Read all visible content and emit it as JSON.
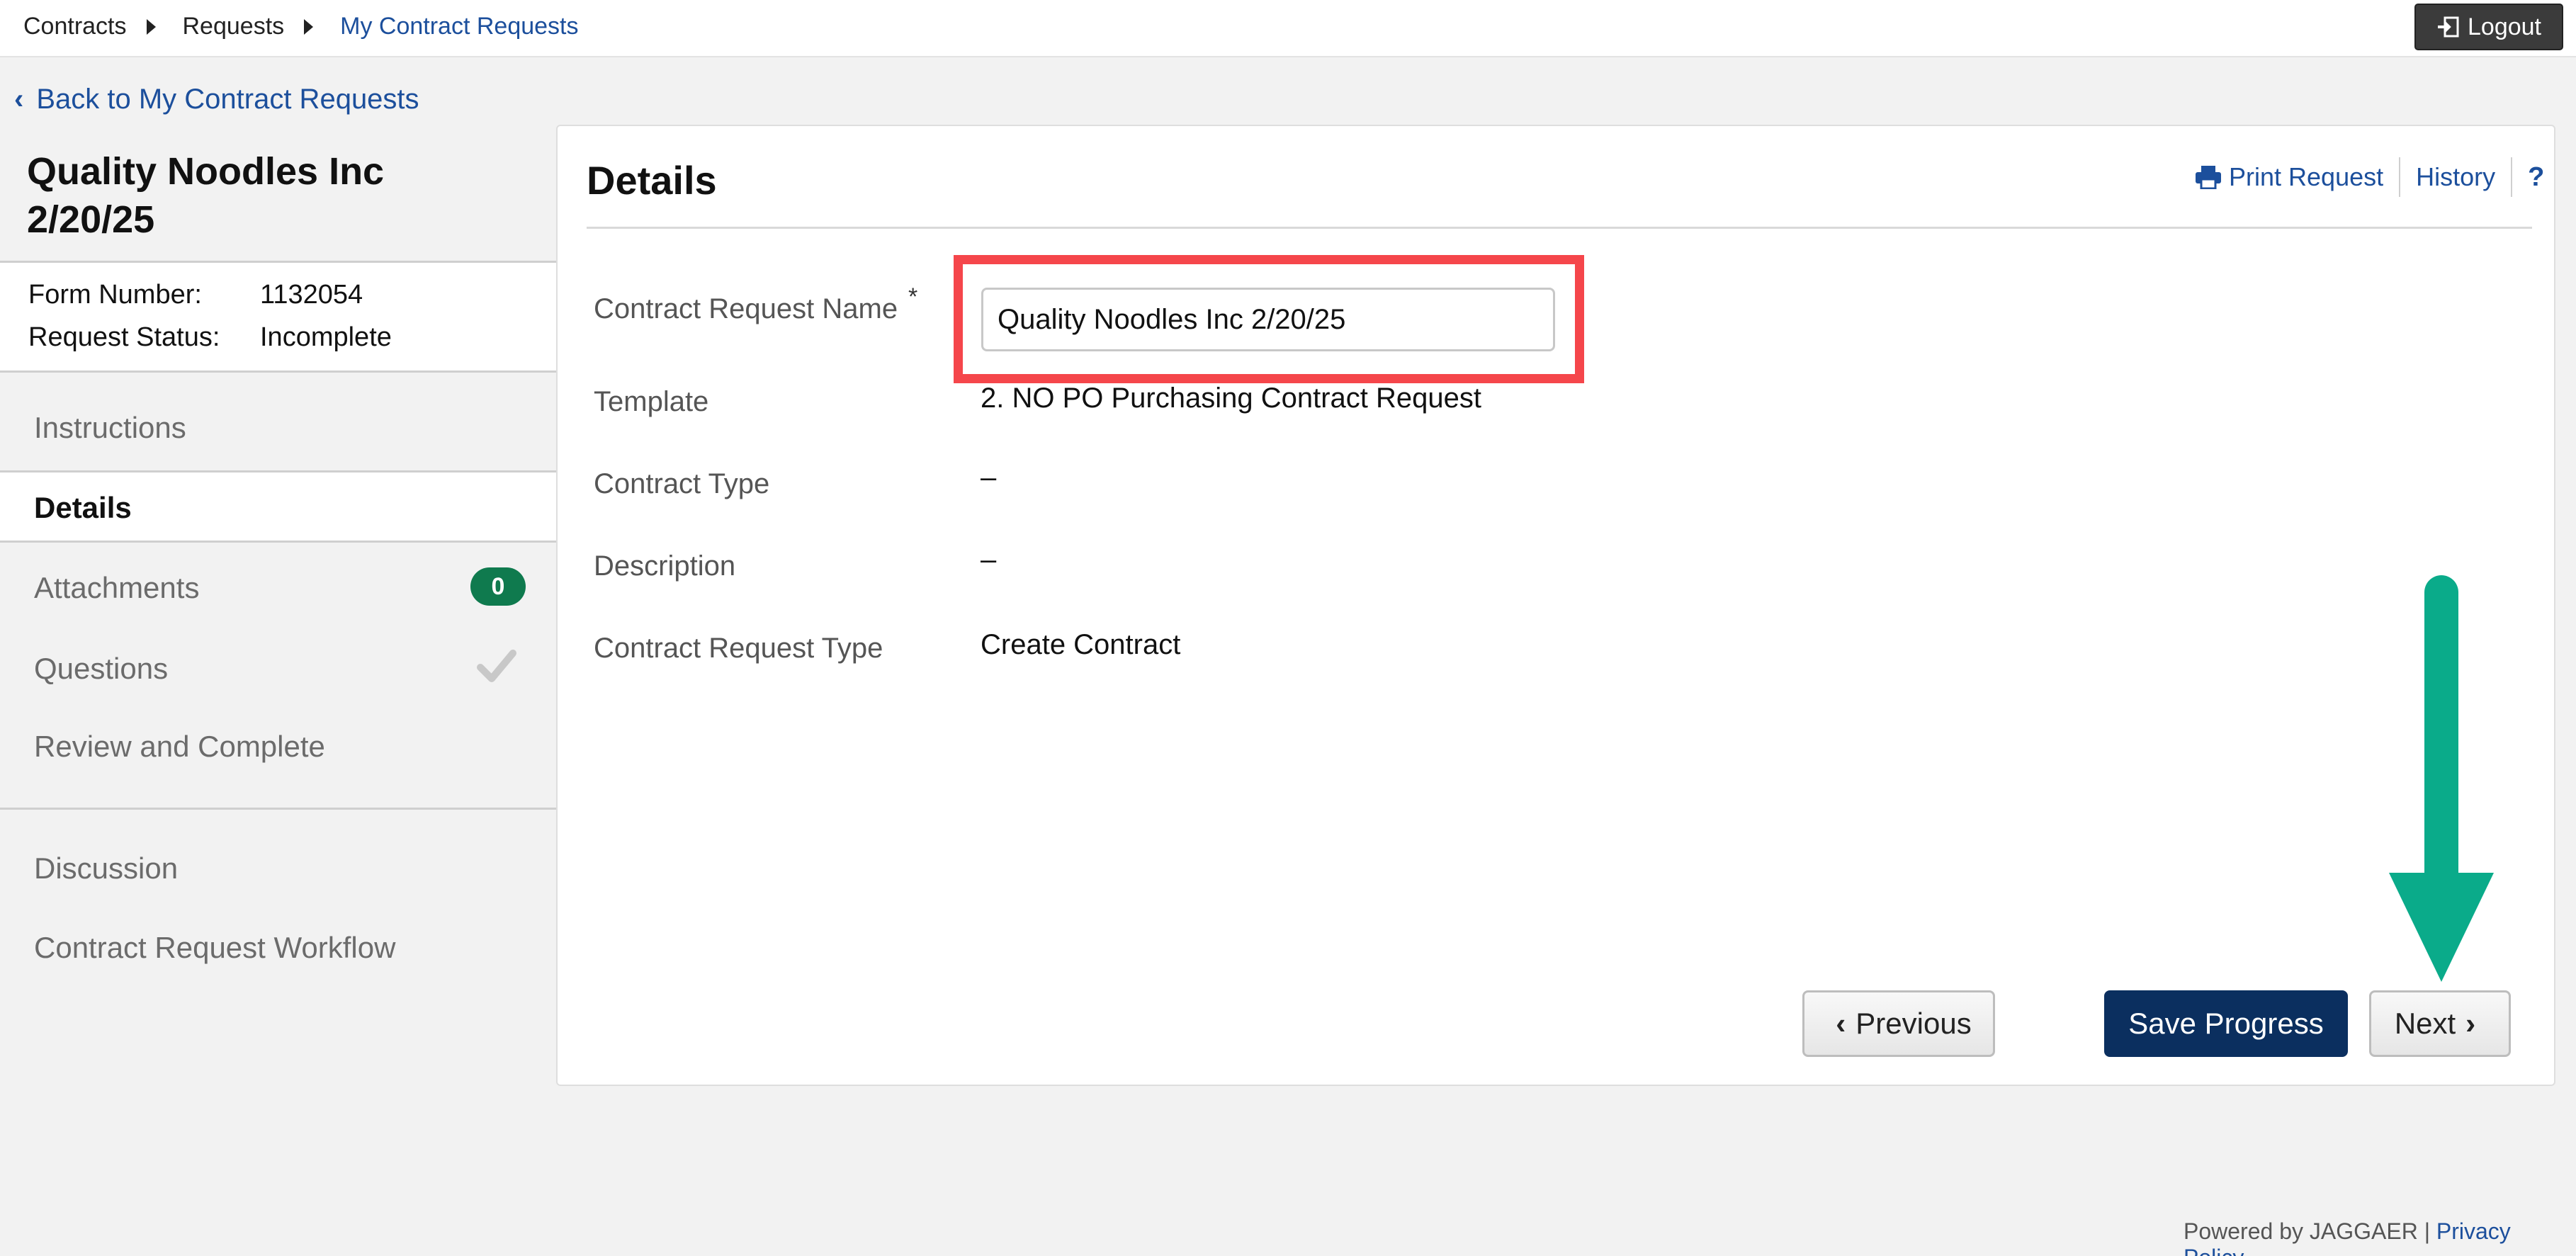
{
  "breadcrumb": {
    "items": [
      "Contracts",
      "Requests",
      "My Contract Requests"
    ]
  },
  "header": {
    "logout_label": "Logout",
    "back_label": "Back to My Contract Requests"
  },
  "sidebar": {
    "title_line1": "Quality Noodles Inc",
    "title_line2": "2/20/25",
    "meta": [
      {
        "label": "Form Number:",
        "value": "1132054"
      },
      {
        "label": "Request Status:",
        "value": "Incomplete"
      }
    ],
    "nav": [
      {
        "label": "Instructions"
      },
      {
        "label": "Details",
        "active": true
      },
      {
        "label": "Attachments",
        "badge": "0"
      },
      {
        "label": "Questions",
        "complete": true
      },
      {
        "label": "Review and Complete"
      },
      {
        "label": "Discussion"
      },
      {
        "label": "Contract Request Workflow"
      }
    ]
  },
  "main": {
    "title": "Details",
    "links": {
      "print": "Print Request",
      "history": "History",
      "help": "?"
    },
    "fields": {
      "name": {
        "label": "Contract Request Name",
        "required_mark": "*",
        "value": "Quality Noodles Inc 2/20/25"
      },
      "template": {
        "label": "Template",
        "value": "2. NO PO Purchasing Contract Request"
      },
      "contract_type": {
        "label": "Contract Type",
        "value": "–"
      },
      "description": {
        "label": "Description",
        "value": "–"
      },
      "request_type": {
        "label": "Contract Request Type",
        "value": "Create Contract"
      }
    },
    "buttons": {
      "previous": "Previous",
      "save": "Save Progress",
      "next": "Next"
    }
  },
  "footer": {
    "powered": "Powered by JAGGAER | ",
    "privacy": "Privacy Policy"
  },
  "colors": {
    "link": "#1c4f9c",
    "primary_button": "#0b2f5f",
    "badge": "#0f7a4e",
    "highlight": "#f5464b",
    "arrow": "#0aab8a"
  }
}
